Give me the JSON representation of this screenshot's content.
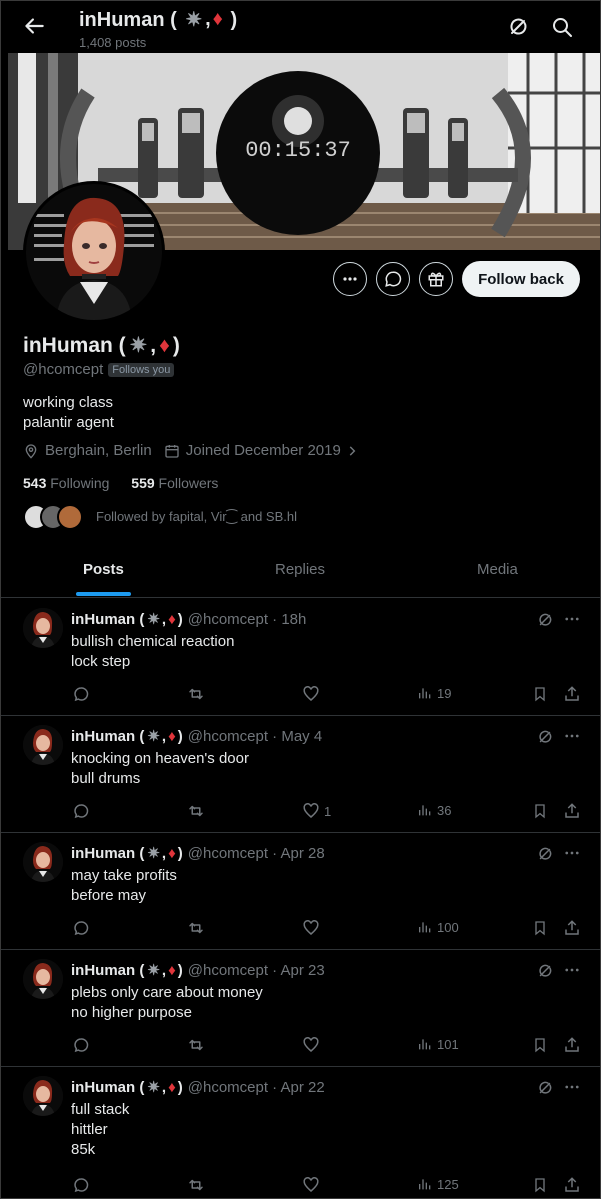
{
  "header": {
    "title": "inHuman (",
    "title_tail": ")",
    "posts_count": "1,408 posts"
  },
  "banner": {
    "clock": "00:15:37"
  },
  "actions": {
    "follow_back_label": "Follow back"
  },
  "profile": {
    "name": "inHuman (",
    "name_tail": ")",
    "handle": "@hcomcept",
    "follows_you": "Follows you",
    "bio_line1": "working class",
    "bio_line2": "palantir agent",
    "location": "Berghain, Berlin",
    "joined": "Joined December 2019",
    "following_count": "543",
    "following_label": "Following",
    "followers_count": "559",
    "followers_label": "Followers",
    "followed_by": "Followed by fapital, Vir⁐ and SB.hl"
  },
  "tabs": [
    "Posts",
    "Replies",
    "Media"
  ],
  "posts": [
    {
      "name": "inHuman (",
      "name_tail": ")",
      "handle": "@hcomcept · 18h",
      "line1": "bullish chemical reaction",
      "line2": "lock step",
      "line3": "",
      "likes": "",
      "views": "19"
    },
    {
      "name": "inHuman (",
      "name_tail": ")",
      "handle": "@hcomcept · May 4",
      "line1": "knocking on heaven's door",
      "line2": "bull drums",
      "line3": "",
      "likes": "1",
      "views": "36"
    },
    {
      "name": "inHuman (",
      "name_tail": ")",
      "handle": "@hcomcept · Apr 28",
      "line1": "may take profits",
      "line2": "before may",
      "line3": "",
      "likes": "",
      "views": "100"
    },
    {
      "name": "inHuman (",
      "name_tail": ")",
      "handle": "@hcomcept · Apr 23",
      "line1": "plebs only care about money",
      "line2": "no higher purpose",
      "line3": "",
      "likes": "",
      "views": "101"
    },
    {
      "name": "inHuman (",
      "name_tail": ")",
      "handle": "@hcomcept · Apr 22",
      "line1": "full stack",
      "line2": "hittler",
      "line3": "85k",
      "likes": "",
      "views": "125"
    }
  ],
  "colors": {
    "accent": "#1d9bf0",
    "diamond": "#e0353b",
    "muted": "#71767b"
  },
  "icons": [
    "back-arrow-icon",
    "grok-icon",
    "search-icon",
    "more-icon",
    "message-icon",
    "gift-icon",
    "location-icon",
    "calendar-icon",
    "chevron-right-icon",
    "reply-icon",
    "repost-icon",
    "like-icon",
    "views-icon",
    "bookmark-icon",
    "share-icon"
  ]
}
